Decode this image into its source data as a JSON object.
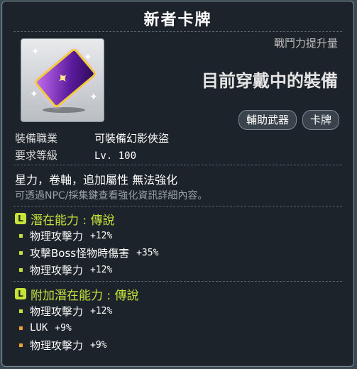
{
  "title": "新者卡牌",
  "power_label": "戰鬥力提升量",
  "equipped_label": "目前穿戴中的裝備",
  "tags": [
    "輔助武器",
    "卡牌"
  ],
  "info": [
    {
      "key": "裝備職業",
      "value": "可裝備幻影俠盜"
    },
    {
      "key": "要求等級",
      "value": "Lv. 100"
    }
  ],
  "upgrade_text": "星力，卷軸，追加屬性 無法強化",
  "hint_text": "可透過NPC/採集鍵查看強化資訊詳細內容。",
  "potential": {
    "badge": "L",
    "title": "潛在能力 : 傳說",
    "title_color": "#c8e23c",
    "lines": [
      {
        "label": "物理攻擊力",
        "value": "+12%"
      },
      {
        "label": "攻擊Boss怪物時傷害",
        "value": "+35%"
      },
      {
        "label": "物理攻擊力",
        "value": "+12%"
      }
    ],
    "bullet_color": "#c8e23c"
  },
  "additional": {
    "badge": "L",
    "title": "附加潛在能力 : 傳說",
    "title_color": "#c8e23c",
    "lines": [
      {
        "label": "物理攻擊力",
        "value": "+12%",
        "bullet": "#c8e23c"
      },
      {
        "label": "LUK",
        "value": "+9%",
        "bullet": "#f0a030"
      },
      {
        "label": "物理攻擊力",
        "value": "+9%",
        "bullet": "#f0a030"
      }
    ]
  },
  "icon": "card-item-icon"
}
